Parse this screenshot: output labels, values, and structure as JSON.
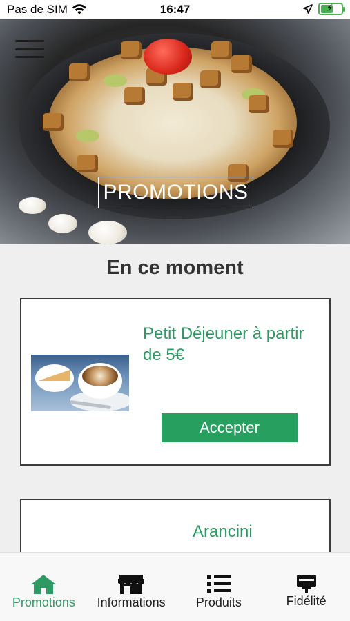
{
  "status_bar": {
    "carrier": "Pas de SIM",
    "time": "16:47",
    "battery_level": 0.6
  },
  "header": {
    "menu_icon": "hamburger-menu-icon",
    "title": "PROMOTIONS"
  },
  "main": {
    "section_title": "En ce moment",
    "promotions": [
      {
        "title": "Petit Déjeuner à partir de 5€",
        "button_label": "Accepter",
        "image": "breakfast-toast-coffee"
      },
      {
        "title": "Arancini"
      }
    ]
  },
  "tab_bar": {
    "items": [
      {
        "label": "Promotions",
        "icon": "home-icon",
        "active": true
      },
      {
        "label": "Informations",
        "icon": "store-icon",
        "active": false
      },
      {
        "label": "Produits",
        "icon": "list-icon",
        "active": false
      },
      {
        "label": "Fidélité",
        "icon": "card-icon",
        "active": false
      }
    ]
  },
  "colors": {
    "accent": "#2e9a63",
    "button": "#27a05f",
    "background": "#efefef"
  }
}
